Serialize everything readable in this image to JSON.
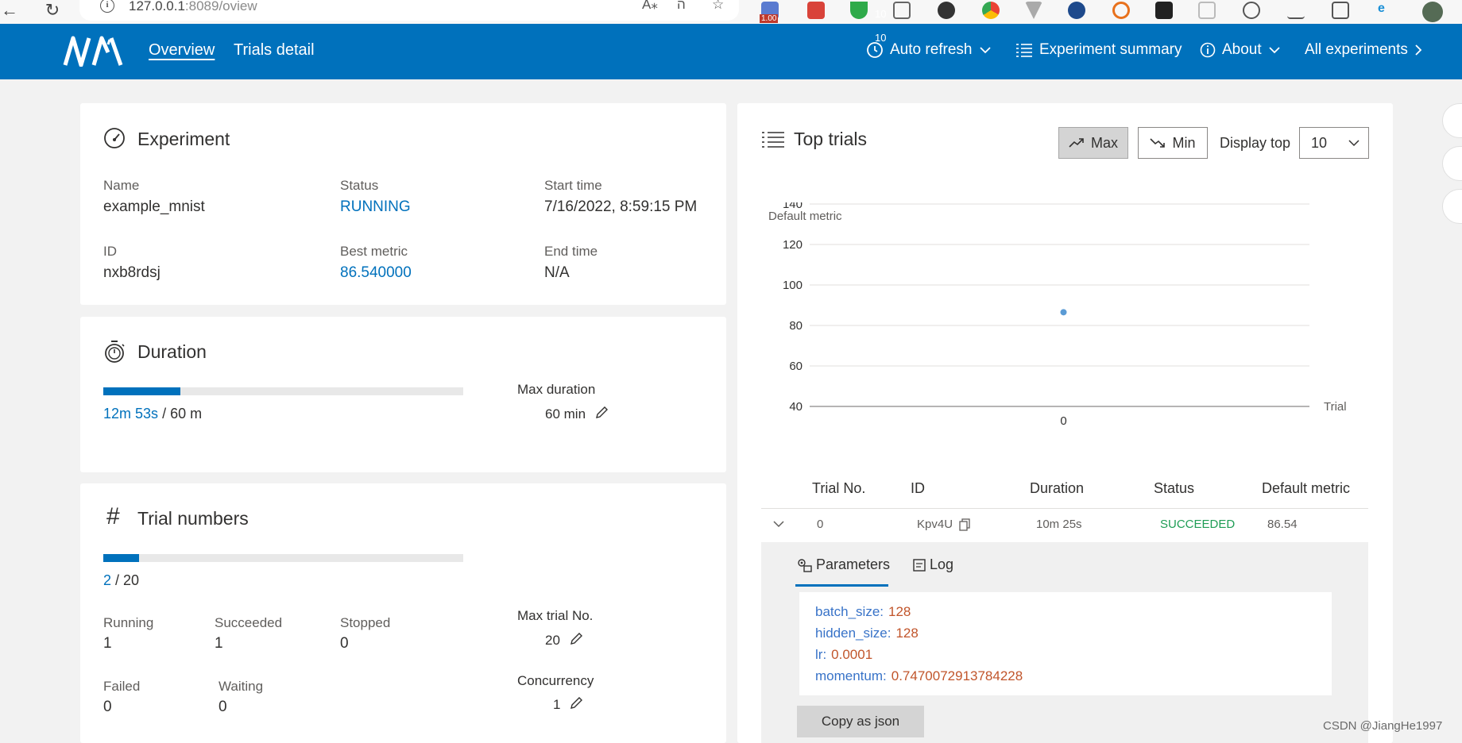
{
  "browser": {
    "url_host": "127.0.0.1",
    "url_rest": ":8089/oview",
    "ext_badge": "1.00"
  },
  "header": {
    "nav": [
      "Overview",
      "Trials detail"
    ],
    "refresh_count": "10",
    "auto_refresh": "Auto refresh",
    "experiment_summary": "Experiment summary",
    "about": "About",
    "all_experiments": "All experiments"
  },
  "experiment": {
    "title": "Experiment",
    "name_label": "Name",
    "name": "example_mnist",
    "status_label": "Status",
    "status": "RUNNING",
    "start_label": "Start time",
    "start": "7/16/2022, 8:59:15 PM",
    "id_label": "ID",
    "id": "nxb8rdsj",
    "best_label": "Best metric",
    "best": "86.540000",
    "end_label": "End time",
    "end": "N/A"
  },
  "duration": {
    "title": "Duration",
    "elapsed": "12m 53s",
    "total": "/ 60 m",
    "progress_pct": 21.5,
    "max_label": "Max duration",
    "max_value": "60 min"
  },
  "trial_numbers": {
    "title": "Trial numbers",
    "done": "2",
    "total": "/ 20",
    "progress_pct": 10,
    "running_label": "Running",
    "running": "1",
    "succeeded_label": "Succeeded",
    "succeeded": "1",
    "stopped_label": "Stopped",
    "stopped": "0",
    "failed_label": "Failed",
    "failed": "0",
    "waiting_label": "Waiting",
    "waiting": "0",
    "max_trial_label": "Max trial No.",
    "max_trial": "20",
    "concurrency_label": "Concurrency",
    "concurrency": "1"
  },
  "top_trials": {
    "title": "Top trials",
    "max_label": "Max",
    "min_label": "Min",
    "display_top_label": "Display top",
    "display_top_value": "10",
    "columns": [
      "Trial No.",
      "ID",
      "Duration",
      "Status",
      "Default metric"
    ],
    "row": {
      "trial": "0",
      "id": "Kpv4U",
      "duration": "10m 25s",
      "status": "SUCCEEDED",
      "metric": "86.54"
    },
    "tabs": [
      "Parameters",
      "Log"
    ],
    "params": [
      {
        "key": "batch_size:",
        "value": "128"
      },
      {
        "key": "hidden_size:",
        "value": "128"
      },
      {
        "key": "lr:",
        "value": "0.0001"
      },
      {
        "key": "momentum:",
        "value": "0.7470072913784228"
      }
    ],
    "copy_label": "Copy as json"
  },
  "chart_data": {
    "type": "scatter",
    "ylabel": "Default metric",
    "xlabel": "Trial",
    "ylim": [
      40,
      140
    ],
    "yticks": [
      "140",
      "120",
      "100",
      "80",
      "60",
      "40"
    ],
    "xticks": [
      "0"
    ],
    "points": [
      {
        "x": 0,
        "y": 86.54
      }
    ]
  },
  "watermark": "CSDN @JiangHe1997",
  "colors": {
    "brand": "#0071bc",
    "success": "#1f9d55",
    "param_value": "#c1552b"
  }
}
